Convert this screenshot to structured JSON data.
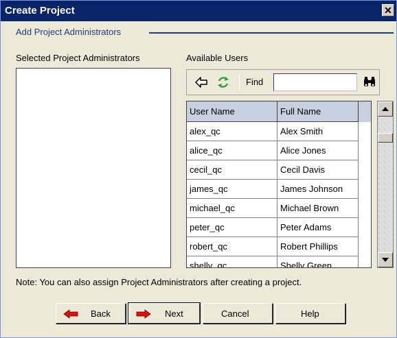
{
  "window": {
    "title": "Create Project",
    "close_glyph": "✕"
  },
  "section": {
    "title": "Add Project Administrators"
  },
  "selected": {
    "label": "Selected Project Administrators"
  },
  "available": {
    "label": "Available Users",
    "find_label": "Find",
    "find_value": "",
    "columns": [
      "User Name",
      "Full Name"
    ],
    "rows": [
      {
        "user": "alex_qc",
        "full": "Alex Smith"
      },
      {
        "user": "alice_qc",
        "full": "Alice Jones"
      },
      {
        "user": "cecil_qc",
        "full": "Cecil Davis"
      },
      {
        "user": "james_qc",
        "full": "James Johnson"
      },
      {
        "user": "michael_qc",
        "full": "Michael Brown"
      },
      {
        "user": "peter_qc",
        "full": "Peter Adams"
      },
      {
        "user": "robert_qc",
        "full": "Robert Phillips"
      },
      {
        "user": "shelly_qc",
        "full": "Shelly Green"
      }
    ]
  },
  "note": "Note: You can also assign Project Administrators after creating a project.",
  "buttons": {
    "back": "Back",
    "next": "Next",
    "cancel": "Cancel",
    "help": "Help"
  },
  "colors": {
    "titlebar": "#0a246a",
    "section_title": "#1e3d7b",
    "grid_header": "#c6d0df",
    "arrow_red": "#e01010",
    "refresh_green": "#2ea043"
  }
}
